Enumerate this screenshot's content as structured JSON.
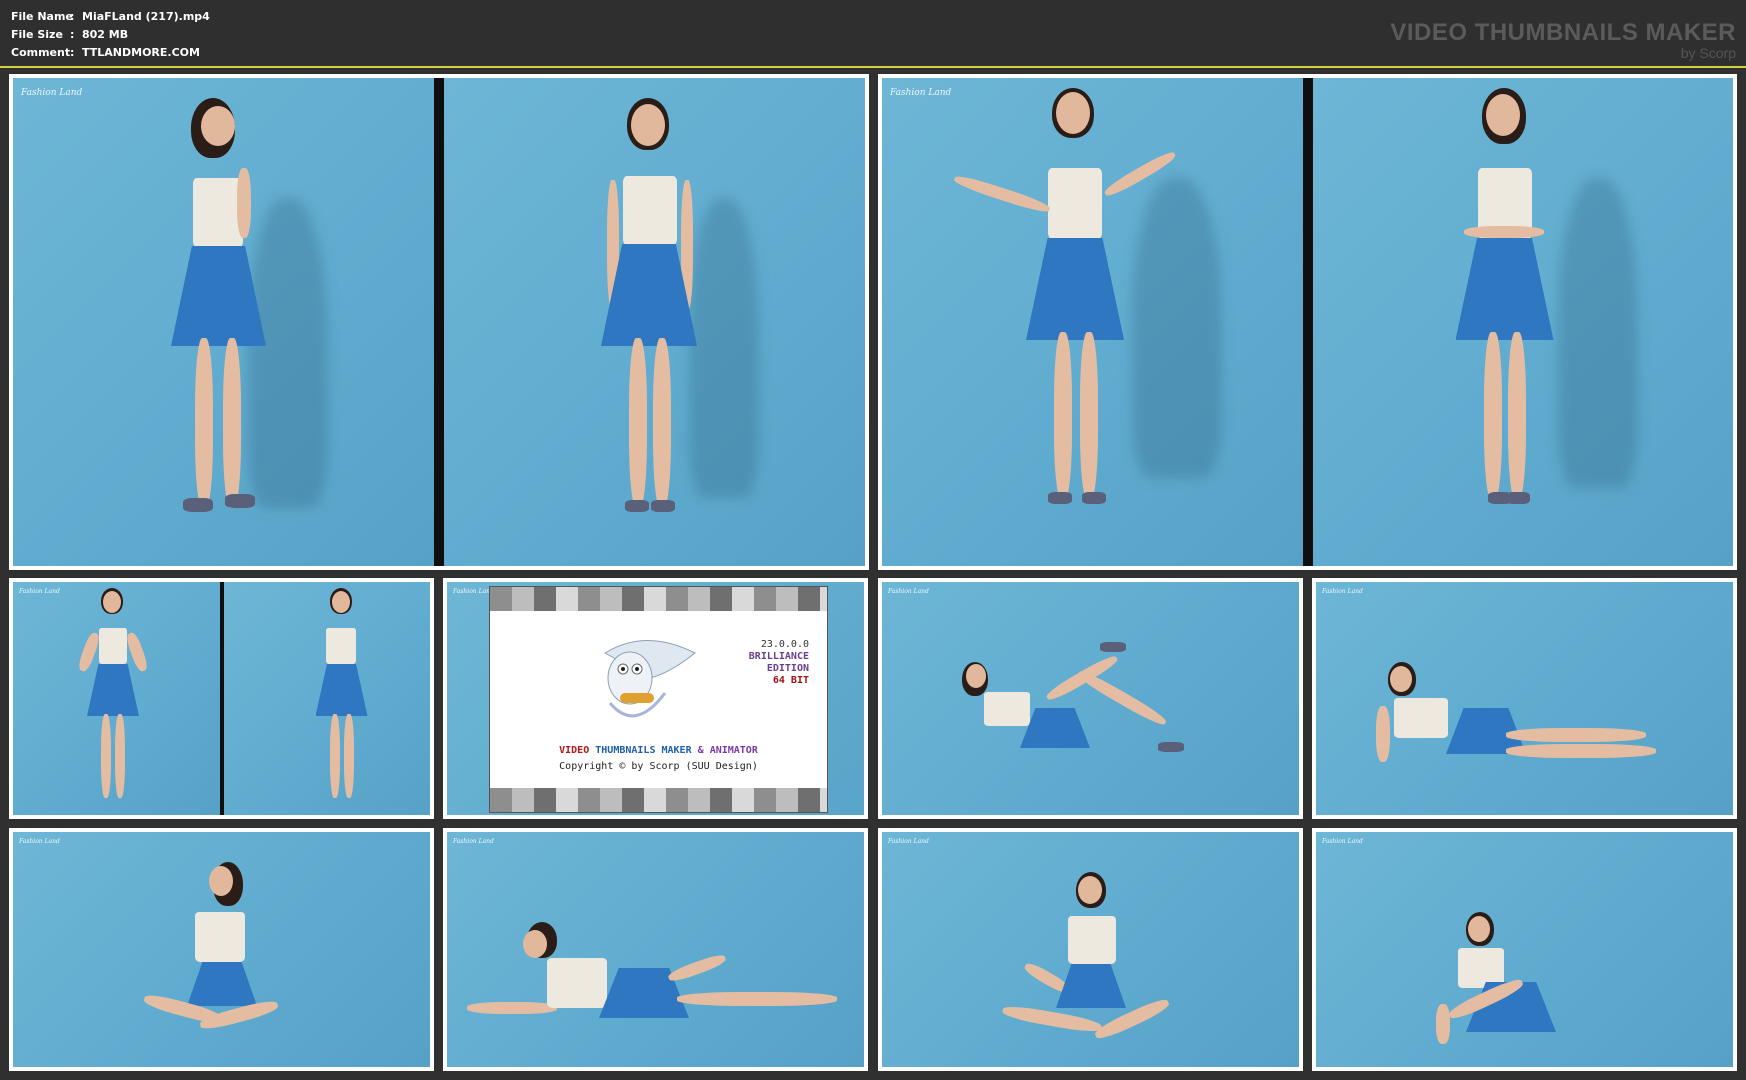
{
  "header": {
    "rows": [
      {
        "key": "File Name",
        "sep": ":",
        "value": "MiaFLand (217).mp4"
      },
      {
        "key": "File Size",
        "sep": ":",
        "value": "802 MB"
      },
      {
        "key": "Comment",
        "sep": ":",
        "value": "TTLANDMORE.COM"
      }
    ],
    "brand_title": "VIDEO THUMBNAILS MAKER",
    "brand_sub": "by Scorp"
  },
  "logo_text": "Fashion Land",
  "splash": {
    "version": "23.0.0.0",
    "edition_1": "BRILLIANCE",
    "edition_2": "EDITION",
    "bits": "64 BIT",
    "title_red": "VIDEO",
    "title_blue": "THUMBNAILS MAKER",
    "title_amp": "&",
    "title_purple": "ANIMATOR",
    "copyright": "Copyright © by Scorp (SUU Design)"
  },
  "colors": {
    "background": "#303030",
    "backdrop": "#5fabcf",
    "skirt": "#2f77c0",
    "accent_line": "#d0d040"
  }
}
